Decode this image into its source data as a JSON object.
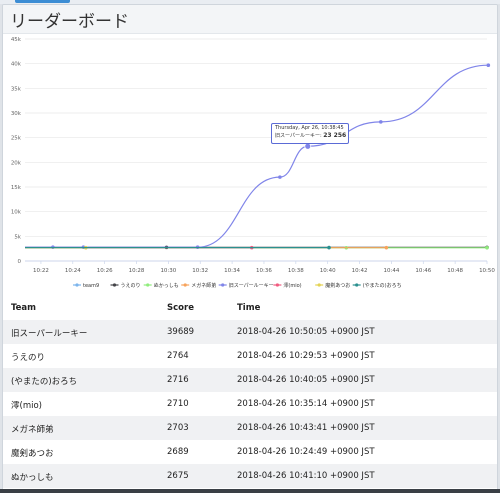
{
  "panel": {
    "title": "リーダーボード"
  },
  "chart_data": {
    "type": "line",
    "y_ticks": [
      "0",
      "5k",
      "10k",
      "15k",
      "20k",
      "25k",
      "30k",
      "35k",
      "40k",
      "45k"
    ],
    "ylim": [
      0,
      45000
    ],
    "x_ticks": [
      "10:22",
      "10:24",
      "10:26",
      "10:28",
      "10:30",
      "10:32",
      "10:34",
      "10:36",
      "10:38",
      "10:40",
      "10:42",
      "10:44",
      "10:46",
      "10:48",
      "10:50"
    ],
    "grid": true,
    "legend_position": "bottom",
    "series": [
      {
        "name": "team9",
        "color": "#7cb5ec",
        "points": []
      },
      {
        "name": "うえのり",
        "color": "#434348",
        "points": [
          [
            "10:21:00",
            2764
          ],
          [
            "10:29:53",
            2764
          ],
          [
            "10:50:00",
            2764
          ]
        ]
      },
      {
        "name": "ぬかっしも",
        "color": "#90ed7d",
        "points": [
          [
            "10:21:00",
            2675
          ],
          [
            "10:41:10",
            2675
          ],
          [
            "10:50:00",
            2675
          ]
        ]
      },
      {
        "name": "メガネ師弟",
        "color": "#f7a35c",
        "points": [
          [
            "10:21:00",
            2703
          ],
          [
            "10:43:41",
            2703
          ]
        ]
      },
      {
        "name": "旧スーパールーキー",
        "color": "#8085e9",
        "points": [
          [
            "10:21:00",
            2800
          ],
          [
            "10:22:45",
            2800
          ],
          [
            "10:24:40",
            2800
          ],
          [
            "10:31:50",
            2800
          ],
          [
            "10:37:00",
            17000
          ],
          [
            "10:38:45",
            23256
          ],
          [
            "10:43:20",
            28200
          ],
          [
            "10:50:05",
            39689
          ]
        ]
      },
      {
        "name": "澪(mio)",
        "color": "#f15c80",
        "points": [
          [
            "10:21:00",
            2710
          ],
          [
            "10:35:14",
            2710
          ]
        ]
      },
      {
        "name": "魔剣あつお",
        "color": "#e4d354",
        "points": [
          [
            "10:21:00",
            2689
          ],
          [
            "10:24:49",
            2689
          ]
        ]
      },
      {
        "name": "(やまたの)おろち",
        "color": "#2b908f",
        "points": [
          [
            "10:21:00",
            2716
          ],
          [
            "10:40:05",
            2716
          ]
        ]
      }
    ],
    "tooltip": {
      "date": "Thursday, Apr 26, 10:38:45",
      "series": "旧スーパールーキー",
      "value": "23 256"
    }
  },
  "table": {
    "headers": {
      "team": "Team",
      "score": "Score",
      "time": "Time"
    },
    "rows": [
      {
        "team": "旧スーパールーキー",
        "score": "39689",
        "time": "2018-04-26 10:50:05 +0900 JST"
      },
      {
        "team": "うえのり",
        "score": "2764",
        "time": "2018-04-26 10:29:53 +0900 JST"
      },
      {
        "team": "(やまたの)おろち",
        "score": "2716",
        "time": "2018-04-26 10:40:05 +0900 JST"
      },
      {
        "team": "澪(mio)",
        "score": "2710",
        "time": "2018-04-26 10:35:14 +0900 JST"
      },
      {
        "team": "メガネ師弟",
        "score": "2703",
        "time": "2018-04-26 10:43:41 +0900 JST"
      },
      {
        "team": "魔剣あつお",
        "score": "2689",
        "time": "2018-04-26 10:24:49 +0900 JST"
      },
      {
        "team": "ぬかっしも",
        "score": "2675",
        "time": "2018-04-26 10:41:10 +0900 JST"
      }
    ]
  }
}
